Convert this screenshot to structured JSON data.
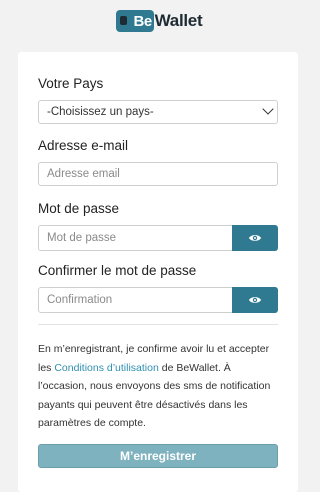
{
  "brand": {
    "mark_text": "Be",
    "name": "Wallet",
    "color": "#2f7a90"
  },
  "form": {
    "country": {
      "label": "Votre Pays",
      "selected": "-Choisissez un pays-"
    },
    "email": {
      "label": "Adresse e-mail",
      "placeholder": "Adresse email",
      "value": ""
    },
    "password": {
      "label": "Mot de passe",
      "placeholder": "Mot de passe",
      "value": "",
      "toggle_icon": "eye-icon"
    },
    "confirm": {
      "label": "Confirmer le mot de passe",
      "placeholder": "Confirmation",
      "value": "",
      "toggle_icon": "eye-icon"
    },
    "terms": {
      "before": "En m’enregistrant, je confirme avoir lu et accepter les ",
      "link": "Conditions d’utilisation",
      "after": " de BeWallet. À l’occasion, nous envoyons des sms de notification payants qui peuvent être désactivés dans les paramètres de compte."
    },
    "submit_label": "M’enregistrer"
  }
}
